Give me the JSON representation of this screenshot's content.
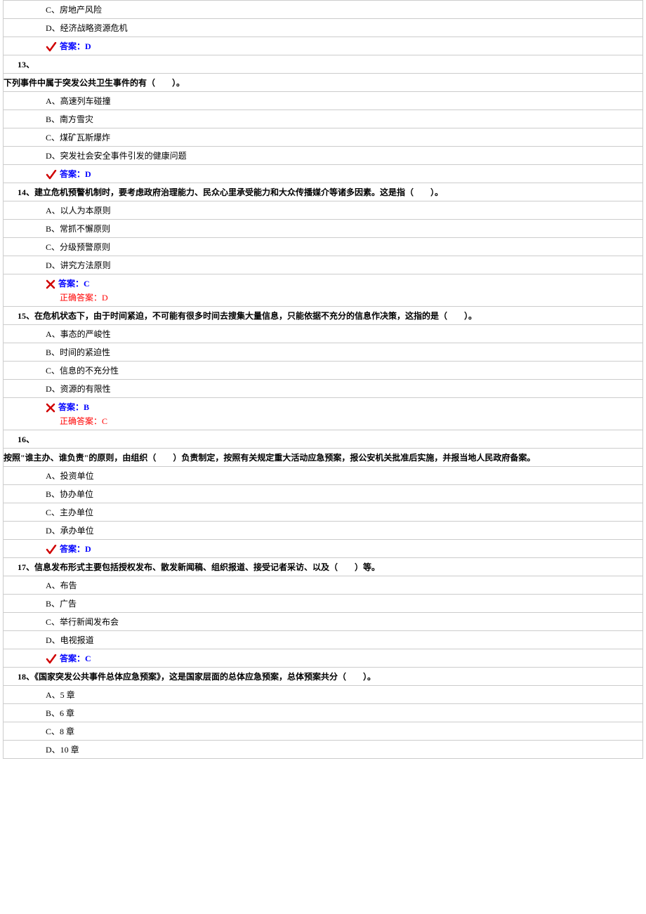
{
  "q12": {
    "optC": "C、房地产风险",
    "optD": "D、经济战略资源危机",
    "ans": "答案：D"
  },
  "q13": {
    "num": "13、",
    "stem": "下列事件中属于突发公共卫生事件的有（　　）。",
    "optA": "A、高速列车碰撞",
    "optB": "B、南方雪灾",
    "optC": "C、煤矿瓦斯爆炸",
    "optD": "D、突发社会安全事件引发的健康问题",
    "ans": "答案：D"
  },
  "q14": {
    "num": "14、",
    "stem": "建立危机预警机制时，要考虑政府治理能力、民众心里承受能力和大众传播媒介等诸多因素。这是指（　　）。",
    "optA": "A、以人为本原则",
    "optB": "B、常抓不懈原则",
    "optC": "C、分级预警原则",
    "optD": "D、讲究方法原则",
    "ans": "答案：C",
    "correct": "正确答案：D"
  },
  "q15": {
    "num": "15、",
    "stem": "在危机状态下，由于时间紧迫，不可能有很多时间去搜集大量信息，只能依据不充分的信息作决策，这指的是（　　）。",
    "optA": "A、事态的严峻性",
    "optB": "B、时间的紧迫性",
    "optC": "C、信息的不充分性",
    "optD": "D、资源的有限性",
    "ans": "答案：B",
    "correct": "正确答案：C"
  },
  "q16": {
    "num": "16、",
    "stem": "按照\"谁主办、谁负责\"的原则，由组织（　　）负责制定，按照有关规定重大活动应急预案，报公安机关批准后实施，并报当地人民政府备案。",
    "optA": "A、投资单位",
    "optB": "B、协办单位",
    "optC": "C、主办单位",
    "optD": "D、承办单位",
    "ans": "答案：D"
  },
  "q17": {
    "num": "17、",
    "stem": "信息发布形式主要包括授权发布、散发新闻稿、组织报道、接受记者采访、以及（　　）等。",
    "optA": "A、布告",
    "optB": "B、广告",
    "optC": "C、举行新闻发布会",
    "optD": "D、电视报道",
    "ans": "答案：C"
  },
  "q18": {
    "num": "18、",
    "stem": "《国家突发公共事件总体应急预案》，这是国家层面的总体应急预案，总体预案共分（　　）。",
    "optA": "A、5 章",
    "optB": "B、6 章",
    "optC": "C、8 章",
    "optD": "D、10 章"
  }
}
